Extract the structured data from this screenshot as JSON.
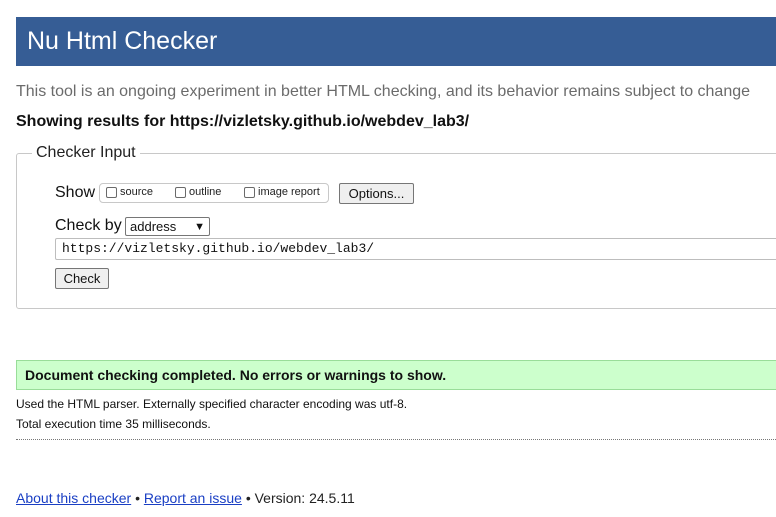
{
  "header": {
    "title": "Nu Html Checker"
  },
  "tagline": "This tool is an ongoing experiment in better HTML checking, and its behavior remains subject to change",
  "results_heading": "Showing results for https://vizletsky.github.io/webdev_lab3/",
  "checker_input": {
    "legend": "Checker Input",
    "show_label": "Show",
    "options": [
      {
        "label": "source",
        "checked": false
      },
      {
        "label": "outline",
        "checked": false
      },
      {
        "label": "image report",
        "checked": false
      }
    ],
    "options_button": "Options...",
    "check_by_label": "Check by",
    "check_by_value": "address",
    "url_value": "https://vizletsky.github.io/webdev_lab3/",
    "check_button": "Check"
  },
  "result": {
    "success_message": "Document checking completed. No errors or warnings to show.",
    "parser_info": "Used the HTML parser. Externally specified character encoding was utf-8.",
    "execution_time": "Total execution time 35 milliseconds."
  },
  "footer": {
    "about_link": "About this checker",
    "separator": "•",
    "report_link": "Report an issue",
    "version": "Version: 24.5.11"
  }
}
